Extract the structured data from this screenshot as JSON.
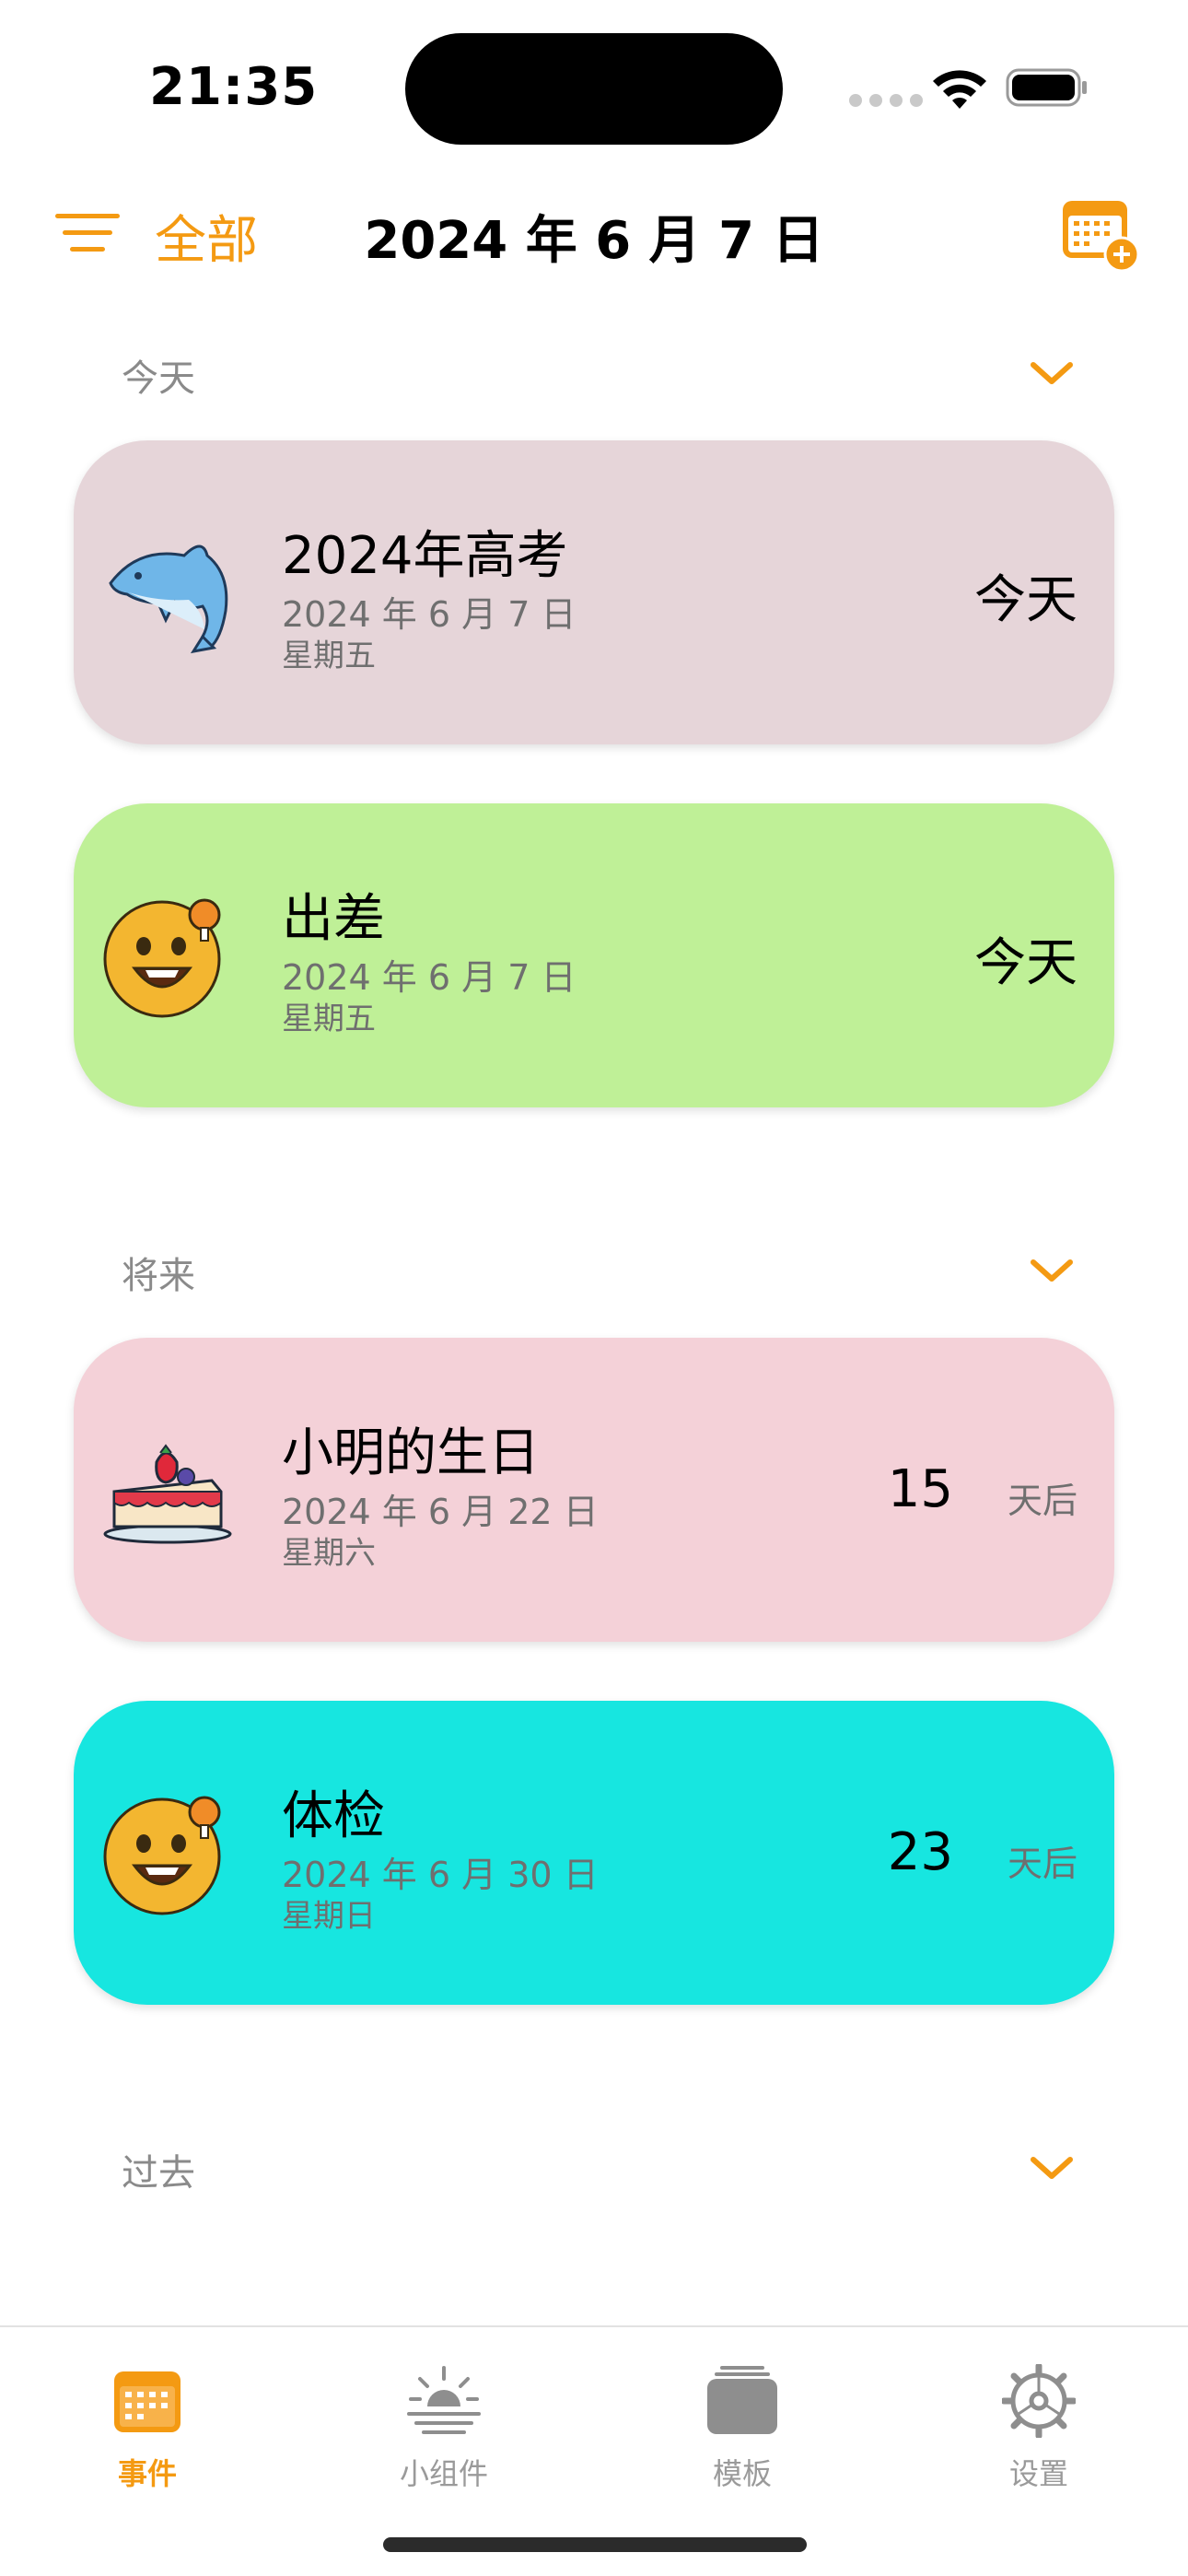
{
  "status_bar": {
    "time": "21:35"
  },
  "nav": {
    "filter_label": "全部",
    "title": "2024 年 6 月 7 日"
  },
  "colors": {
    "accent": "#f49a12"
  },
  "sections": {
    "today": {
      "title": "今天"
    },
    "future": {
      "title": "将来"
    },
    "past": {
      "title": "过去"
    }
  },
  "events": [
    {
      "name": "2024年高考",
      "date": "2024 年 6 月 7 日",
      "weekday": "星期五",
      "status": "今天",
      "icon": "dolphin-icon",
      "color": "#e6d5d9"
    },
    {
      "name": "出差",
      "date": "2024 年 6 月 7 日",
      "weekday": "星期五",
      "status": "今天",
      "icon": "happy-face-icon",
      "color": "#bff097"
    },
    {
      "name": "小明的生日",
      "date": "2024 年 6 月 22 日",
      "weekday": "星期六",
      "count": "15",
      "unit": "天后",
      "icon": "cake-icon",
      "color": "#f4d1d8"
    },
    {
      "name": "体检",
      "date": "2024 年 6 月 30 日",
      "weekday": "星期日",
      "count": "23",
      "unit": "天后",
      "icon": "happy-face-icon",
      "color": "#17e6e0"
    }
  ],
  "tabs": [
    {
      "label": "事件",
      "icon": "calendar-icon",
      "active": true
    },
    {
      "label": "小组件",
      "icon": "sunrise-icon",
      "active": false
    },
    {
      "label": "模板",
      "icon": "stack-icon",
      "active": false
    },
    {
      "label": "设置",
      "icon": "gear-icon",
      "active": false
    }
  ]
}
